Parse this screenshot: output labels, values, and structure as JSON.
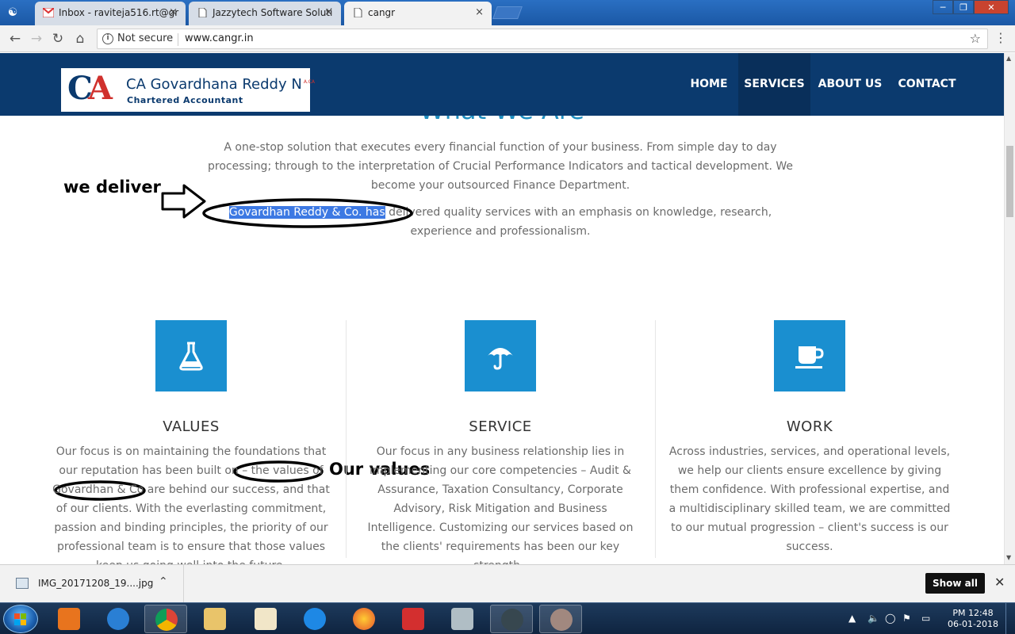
{
  "browser": {
    "tabs": [
      {
        "title": "Inbox - raviteja516.rt@gr",
        "icon": "gmail-icon",
        "close": "×"
      },
      {
        "title": "Jazzytech Software Soluti",
        "icon": "page-icon",
        "close": "×"
      },
      {
        "title": "cangr",
        "icon": "page-icon",
        "close": "×"
      }
    ],
    "security_label": "Not secure",
    "url": "www.cangr.in",
    "window_controls": [
      "─",
      "❐",
      "✕"
    ]
  },
  "site": {
    "logo": {
      "mark_c": "C",
      "mark_a": "A",
      "name": "CA Govardhana Reddy N",
      "suffix": "A.CA",
      "tagline": "Chartered Accountant"
    },
    "nav": [
      "HOME",
      "SERVICES",
      "ABOUT US",
      "CONTACT"
    ],
    "active_nav": "SERVICES",
    "section_title": "What We Are",
    "intro_paragraph": "A one-stop solution that executes every financial function of your business. From simple day to day processing; through to the interpretation of Crucial Performance Indicators and tactical development. We become your outsourced Finance Department.",
    "deliver_highlight": "Govardhan Reddy & Co. has",
    "deliver_rest": " delivered quality services with an emphasis on knowledge, research, experience and professionalism.",
    "annotations": {
      "we_deliver": "we deliver",
      "our_values": "Our values"
    },
    "features": [
      {
        "icon": "flask-icon",
        "title": "VALUES",
        "body": "Our focus is on maintaining the foundations that our reputation has been built on – the values of Govardhan & Co are behind our success, and that of our clients. With the everlasting commitment, passion and binding principles, the priority of our professional team is to ensure that those values keep us going well into the future."
      },
      {
        "icon": "umbrella-icon",
        "title": "SERVICE",
        "body": "Our focus in any business relationship lies in implementing our core competencies – Audit & Assurance, Taxation Consultancy, Corporate Advisory, Risk Mitigation and Business Intelligence. Customizing our services based on the clients' requirements has been our key strength.."
      },
      {
        "icon": "coffee-cup-icon",
        "title": "WORK",
        "body": "Across industries, services, and operational levels, we help our clients ensure excellence by giving them confidence. With professional expertise, and a multidisciplinary skilled team, we are committed to our mutual progression – client's success is our success."
      }
    ]
  },
  "downloads": {
    "file": "IMG_20171208_19....jpg",
    "show_all": "Show all"
  },
  "taskbar": {
    "time": "PM 12:48",
    "date": "06-01-2018"
  },
  "colors": {
    "header": "#0b3a6e",
    "accent": "#1a8fd0",
    "highlight": "#3d79e3"
  }
}
